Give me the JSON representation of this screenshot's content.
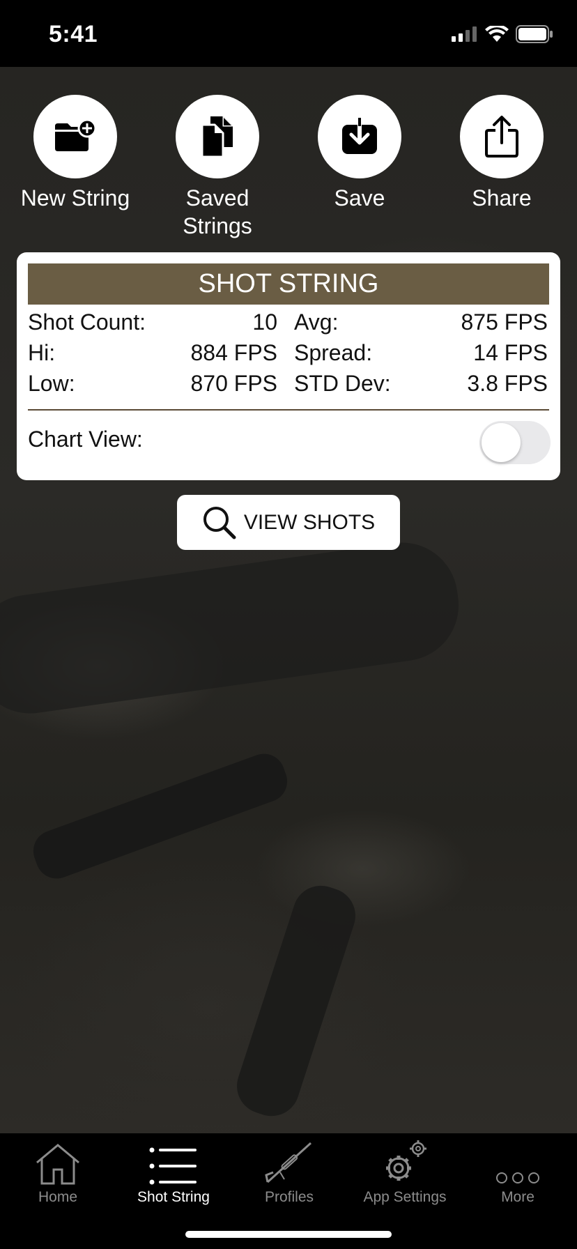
{
  "status": {
    "time": "5:41"
  },
  "actions": [
    {
      "label": "New String",
      "icon": "folder-plus-icon"
    },
    {
      "label": "Saved\nStrings",
      "icon": "documents-icon"
    },
    {
      "label": "Save",
      "icon": "save-download-icon"
    },
    {
      "label": "Share",
      "icon": "share-icon"
    }
  ],
  "card": {
    "title": "SHOT STRING",
    "stats": {
      "shot_count_label": "Shot Count:",
      "shot_count_value": "10",
      "avg_label": "Avg:",
      "avg_value": "875 FPS",
      "hi_label": "Hi:",
      "hi_value": "884 FPS",
      "spread_label": "Spread:",
      "spread_value": "14 FPS",
      "low_label": "Low:",
      "low_value": "870 FPS",
      "std_label": "STD Dev:",
      "std_value": "3.8 FPS"
    },
    "chart_view_label": "Chart View:",
    "chart_view_on": false
  },
  "view_shots": {
    "label": "VIEW SHOTS"
  },
  "tabs": [
    {
      "label": "Home",
      "active": false
    },
    {
      "label": "Shot String",
      "active": true
    },
    {
      "label": "Profiles",
      "active": false
    },
    {
      "label": "App Settings",
      "active": false
    },
    {
      "label": "More",
      "active": false
    }
  ],
  "colors": {
    "header_bg": "#6a5d44",
    "divider": "#5a4a35"
  }
}
